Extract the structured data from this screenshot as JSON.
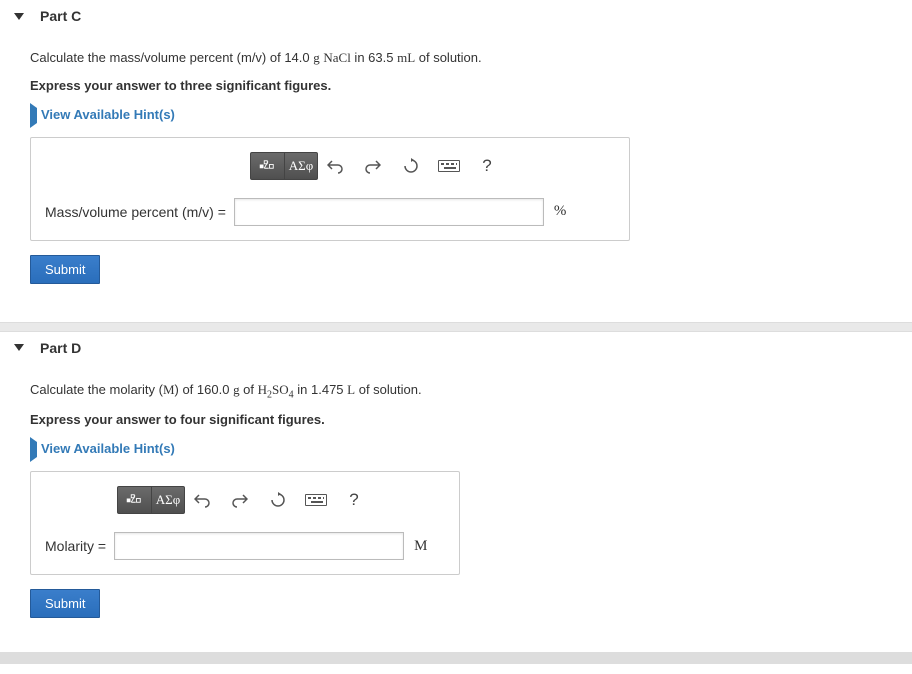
{
  "parts": {
    "c": {
      "title": "Part C",
      "prompt_pre": "Calculate the mass/volume percent (m/v) of 14.0 ",
      "prompt_g": "g",
      "prompt_mid1": " ",
      "prompt_formula": "NaCl",
      "prompt_mid2": " in 63.5 ",
      "prompt_mL": "mL",
      "prompt_post": " of solution.",
      "instruction": "Express your answer to three significant figures.",
      "hints": "View Available Hint(s)",
      "input_label": "Mass/volume percent (m/v) =",
      "unit": "%",
      "submit": "Submit"
    },
    "d": {
      "title": "Part D",
      "prompt_pre": "Calculate the molarity (",
      "prompt_Msym": "M",
      "prompt_mid0": ") of 160.0 ",
      "prompt_g": "g",
      "prompt_mid1": " of ",
      "prompt_formula_1": "H",
      "prompt_formula_sub1": "2",
      "prompt_formula_2": "SO",
      "prompt_formula_sub2": "4",
      "prompt_mid2": " in 1.475 ",
      "prompt_L": "L",
      "prompt_post": " of solution.",
      "instruction": "Express your answer to four significant figures.",
      "hints": "View Available Hint(s)",
      "input_label": "Molarity =",
      "unit": "M",
      "submit": "Submit"
    }
  },
  "toolbar": {
    "greek": "ΑΣφ",
    "help": "?"
  }
}
